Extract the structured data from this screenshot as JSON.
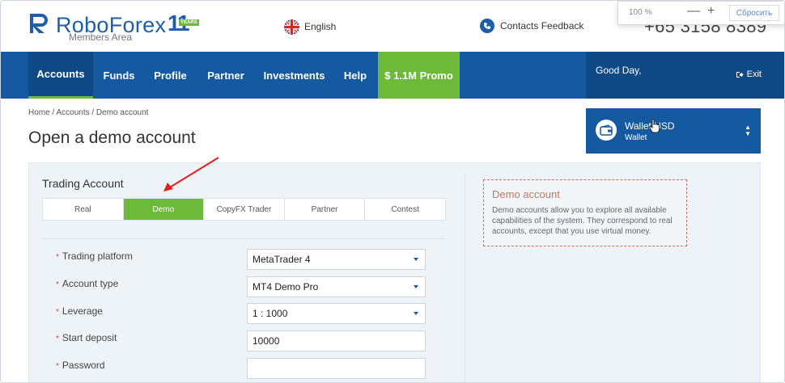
{
  "header": {
    "logo_text": "RoboForex",
    "logo_sub": "Members Area",
    "logo_anniversary": "11",
    "logo_years": "YEARS",
    "language": "English",
    "contacts": "Contacts Feedback",
    "phone": "+65 3158 8389"
  },
  "zoom": {
    "value": "100 %",
    "minus": "—",
    "plus": "+",
    "reset": "Сбросить"
  },
  "nav": {
    "items": [
      {
        "label": "Accounts"
      },
      {
        "label": "Funds"
      },
      {
        "label": "Profile"
      },
      {
        "label": "Partner"
      },
      {
        "label": "Investments"
      },
      {
        "label": "Help"
      },
      {
        "label": "$ 1.1M Promo"
      }
    ],
    "greeting": "Good Day,",
    "exit": "Exit"
  },
  "breadcrumb": "Home / Accounts / Demo account",
  "page_title": "Open a demo account",
  "wallet": {
    "name": "Wallet USD",
    "sub": "Wallet"
  },
  "form": {
    "section_title": "Trading Account",
    "tabs": [
      {
        "label": "Real"
      },
      {
        "label": "Demo"
      },
      {
        "label": "CopyFX Trader"
      },
      {
        "label": "Partner"
      },
      {
        "label": "Contest"
      }
    ],
    "required_mark": "*",
    "fields": {
      "platform": {
        "label": "Trading platform",
        "value": "MetaTrader 4"
      },
      "account_type": {
        "label": "Account type",
        "value": "MT4 Demo Pro"
      },
      "leverage": {
        "label": "Leverage",
        "value": "1 : 1000"
      },
      "deposit": {
        "label": "Start deposit",
        "value": "10000"
      },
      "password": {
        "label": "Password",
        "value": ""
      }
    }
  },
  "info": {
    "title": "Demo account",
    "text": "Demo accounts allow you to explore all available capabilities of the system. They correspond to real accounts, except that you use virtual money."
  },
  "colors": {
    "brand_blue": "#155aa0",
    "accent_green": "#6dba3a",
    "annotation_red": "#e02020"
  }
}
